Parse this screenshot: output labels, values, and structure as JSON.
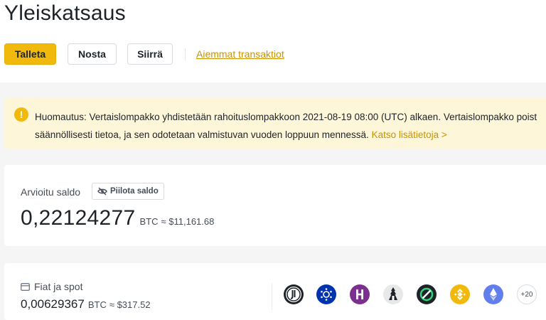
{
  "page": {
    "title": "Yleiskatsaus"
  },
  "actions": {
    "deposit": "Talleta",
    "withdraw": "Nosta",
    "transfer": "Siirrä",
    "history_link": "Aiemmat transaktiot"
  },
  "notice": {
    "icon": "exclamation-icon",
    "line1": "Huomautus: Vertaislompakko yhdistetään rahoituslompakkoon 2021-08-19 08:00 (UTC) alkaen. Vertaislompakko poist",
    "line2": "säännöllisesti tietoa, ja sen odotetaan valmistuvan vuoden loppuun mennessä.",
    "link": "Katso lisätietoja >"
  },
  "balance": {
    "label": "Arvioitu saldo",
    "hide_button": "Piilota saldo",
    "amount": "0,22124277",
    "unit": "BTC",
    "approx": "≈ $11,161.68"
  },
  "spot": {
    "label": "Fiat ja spot",
    "amount": "0,00629367",
    "unit": "BTC",
    "approx": "≈ $317.52",
    "more_label": "+20",
    "coin_icons": [
      "juventus-coin-icon",
      "cardano-coin-icon",
      "hive-coin-icon",
      "tower-coin-icon",
      "ring-coin-icon",
      "bnb-coin-icon",
      "ethereum-coin-icon"
    ]
  },
  "colors": {
    "accent": "#f0b90b",
    "link": "#c99400",
    "notice_bg": "#fef6d8",
    "page_bg": "#f5f5f5"
  }
}
